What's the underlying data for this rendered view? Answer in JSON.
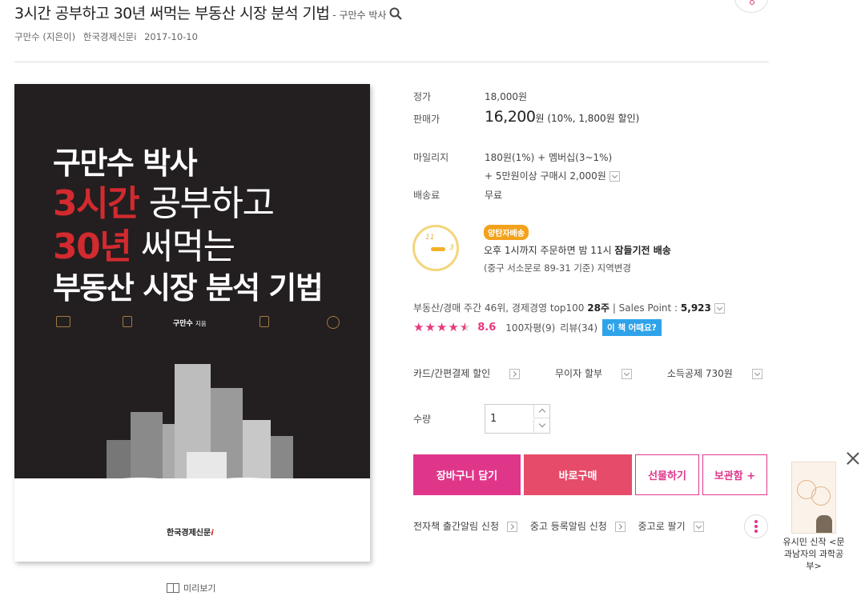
{
  "header": {
    "title": "3시간 공부하고 30년 써먹는 부동산 시장 분석 기법",
    "title_author": "- 구만수 박사"
  },
  "meta": {
    "author": "구만수 (지은이)",
    "publisher": "한국경제신문i",
    "date": "2017-10-10"
  },
  "cover": {
    "line1": "구만수 박사",
    "line2_red": "3시간",
    "line2_rest": " 공부하고",
    "line3_red": "30년",
    "line3_rest": " 써먹는",
    "line4": "부동산 시장 분석 기법",
    "author": "구만수",
    "author_suffix": "지음",
    "publisher": "한국경제신문",
    "publisher_i": "i",
    "preview_label": "미리보기"
  },
  "price": {
    "list_label": "정가",
    "list_value": "18,000원",
    "sale_label": "판매가",
    "sale_value": "16,200",
    "sale_unit": "원",
    "discount": "(10%, 1,800원 할인)"
  },
  "mileage": {
    "label": "마일리지",
    "line1": "180원(1%) + 멤버십(3~1%)",
    "line2": "+ 5만원이상 구매시 2,000원"
  },
  "shipping": {
    "label": "배송료",
    "value": "무료"
  },
  "delivery": {
    "badge": "양탄자배송",
    "text_a": "오후 1시까지 주문하면 밤 11시 ",
    "text_b": "잠들기전 배송",
    "sub": "(중구 서소문로 89-31 기준) 지역변경",
    "clock_11": "11",
    "clock_3": "3"
  },
  "ranking": {
    "text_a": "부동산/경매 주간 46위, 경제경영 top100 ",
    "weeks": "28주",
    "sep": " | ",
    "sp_label": "Sales Point : ",
    "sp_value": "5,923"
  },
  "rating": {
    "score": "8.6",
    "short_review": "100자평(9)",
    "review": "리뷰(34)",
    "ask_button": "이 책 어때요?"
  },
  "options": {
    "card": "카드/간편결제 할인",
    "installment": "무이자 할부",
    "deduction": "소득공제 730원"
  },
  "quantity": {
    "label": "수량",
    "value": "1"
  },
  "buttons": {
    "cart": "장바구니 담기",
    "buy": "바로구매",
    "gift": "선물하기",
    "save": "보관함 +"
  },
  "alerts": {
    "ebook": "전자책 출간알림 신청",
    "used_register": "중고 등록알림 신청",
    "sell_used": "중고로 팔기"
  },
  "side_ad": {
    "caption": "유시민 신작 <문과남자의 과학공부>"
  },
  "colors": {
    "accent": "#e0368a",
    "buy": "#e64c6a",
    "cover_red": "#d32a2f",
    "badge": "#f2a21b",
    "ask": "#2fa3ea"
  }
}
